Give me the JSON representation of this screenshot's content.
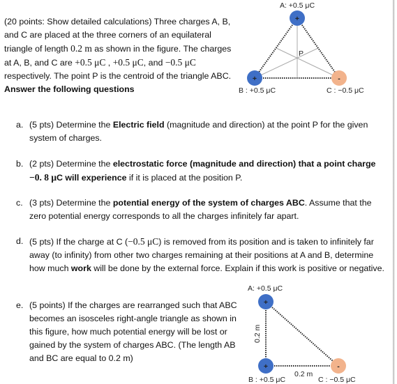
{
  "intro": {
    "p1": "(20 points: Show detailed calculations) Three charges A, B, and C are placed at the three corners of an equilateral triangle of length ",
    "length": "0.2 m",
    "p2": " as shown in the figure. The charges at A, B, and C are ",
    "qa": "+0.5 μC",
    "p3": " , ",
    "qb": "+0.5 μC",
    "p4": ", and ",
    "qc": "−0.5 μC",
    "p5": " respectively.  The point P is the centroid of the triangle ABC. ",
    "bold": "Answer the following questions"
  },
  "questions": {
    "a": {
      "letter": "a.",
      "t1": "(5 pts) Determine the ",
      "b1": "Electric field",
      "t2": " (magnitude and direction) at the point P for the given system of charges."
    },
    "b": {
      "letter": "b.",
      "t1": "(2 pts) Determine the ",
      "b1": "electrostatic force (magnitude and direction) that a point charge ",
      "m1": "−0. 8 μ",
      "b2": "C will experience",
      "t2": " if it is placed at the position P."
    },
    "c": {
      "letter": "c.",
      "t1": "(3 pts) Determine the ",
      "b1": "potential energy of the system of charges ABC",
      "t2": ". Assume that the zero potential energy corresponds to all the charges infinitely far apart."
    },
    "d": {
      "letter": "d.",
      "t1": "(5 pts) If the charge at C (",
      "m1": "−0.5 μC",
      "t2": ") is removed from its position and is taken to infinitely far away (to infinity) from other two charges remaining at their positions at A and B, determine how much ",
      "b1": "work",
      "t3": " will be done by the external force. Explain if this work is positive or negative."
    },
    "e": {
      "letter": "e.",
      "t1": "(5 points) If the charges are rearranged such that ABC becomes an isosceles right-angle triangle as shown in this figure, how much potential energy will be lost or gained by the system of charges ABC. (The length AB and BC are equal to 0.2 m)"
    }
  },
  "figure1": {
    "label_a": "A: +0.5 μC",
    "label_b": "B : +0.5 μC",
    "label_c": "C : −0.5 μC",
    "label_p": "P",
    "sign_a": "+",
    "sign_b": "+",
    "sign_c": "-"
  },
  "figure2": {
    "label_a": "A: +0.5 μC",
    "label_b": "B : +0.5 μC",
    "label_c": "C : −0.5 μC",
    "label_ab": "0.2 m",
    "label_bc": "0.2 m",
    "sign_a": "+",
    "sign_b": "+",
    "sign_c": "-"
  },
  "colors": {
    "positive": "#3f6fc6",
    "negative": "#f2b38c"
  }
}
